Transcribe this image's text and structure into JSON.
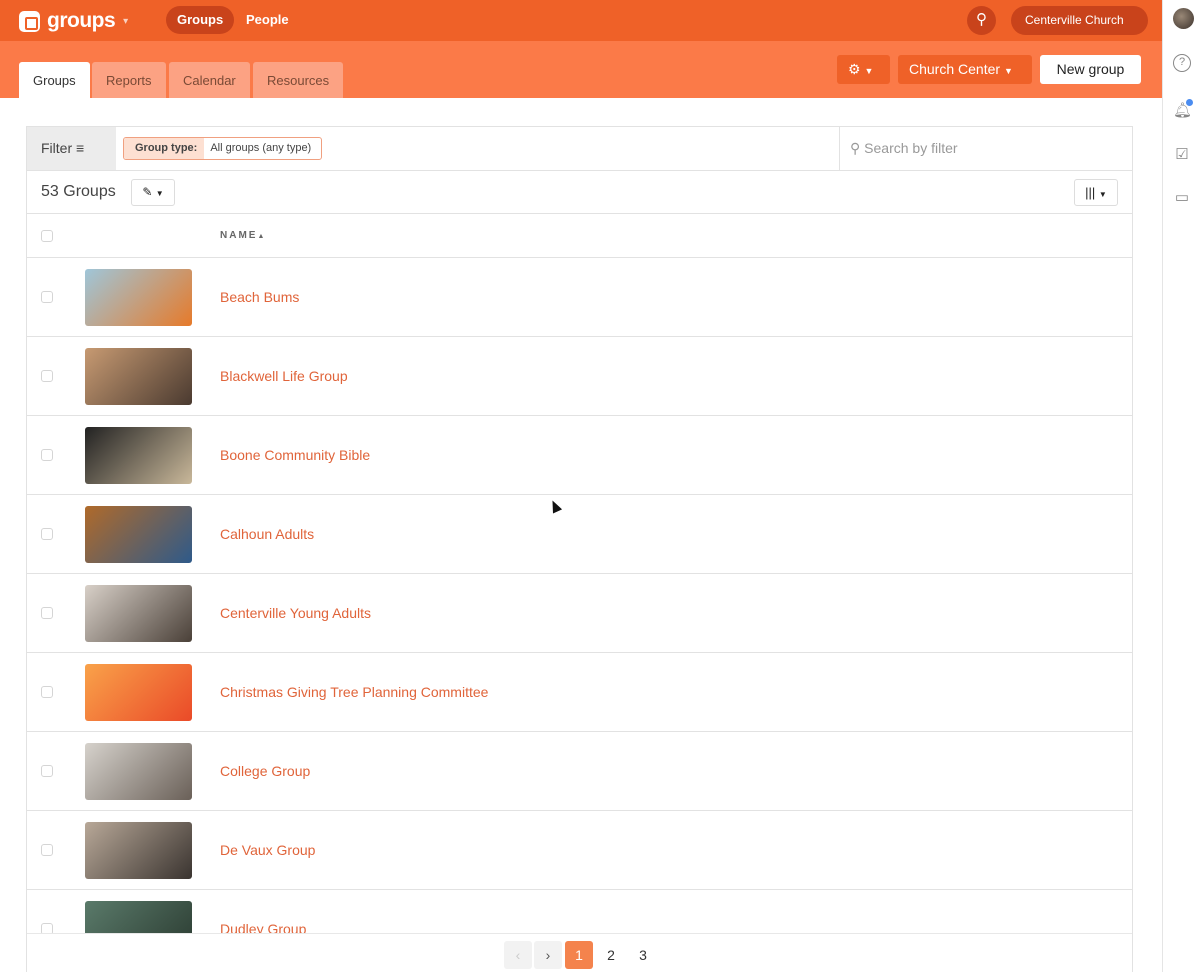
{
  "app": {
    "name": "groups",
    "nav": [
      "Groups",
      "People"
    ],
    "org": "Centerville Church"
  },
  "tabs": [
    "Groups",
    "Reports",
    "Calendar",
    "Resources"
  ],
  "actions": {
    "church_center": "Church Center",
    "new_group": "New group"
  },
  "filter": {
    "label": "Filter",
    "chip_key": "Group type:",
    "chip_value": "All groups (any type)",
    "search_placeholder": "Search by filter"
  },
  "count": "53 Groups",
  "table": {
    "header": "NAME"
  },
  "groups": [
    {
      "name": "Beach Bums",
      "colors": [
        "#9fc6d9",
        "#e67a2a"
      ]
    },
    {
      "name": "Blackwell Life Group",
      "colors": [
        "#c79a72",
        "#4a3a30"
      ]
    },
    {
      "name": "Boone Community Bible",
      "colors": [
        "#222",
        "#c9b89a"
      ]
    },
    {
      "name": "Calhoun Adults",
      "colors": [
        "#b06a2a",
        "#2e5a8a"
      ]
    },
    {
      "name": "Centerville Young Adults",
      "colors": [
        "#d8d0c8",
        "#4a4038"
      ]
    },
    {
      "name": "Christmas Giving Tree Planning Committee",
      "colors": [
        "#f9a24a",
        "#ea4a28"
      ]
    },
    {
      "name": "College Group",
      "colors": [
        "#d6d2cc",
        "#6a6058"
      ]
    },
    {
      "name": "De Vaux Group",
      "colors": [
        "#b8a898",
        "#3a3430"
      ]
    },
    {
      "name": "Dudley Group",
      "colors": [
        "#5a7a6a",
        "#2a3a30"
      ]
    }
  ],
  "pagination": {
    "pages": [
      "1",
      "2",
      "3"
    ],
    "current": "1"
  }
}
